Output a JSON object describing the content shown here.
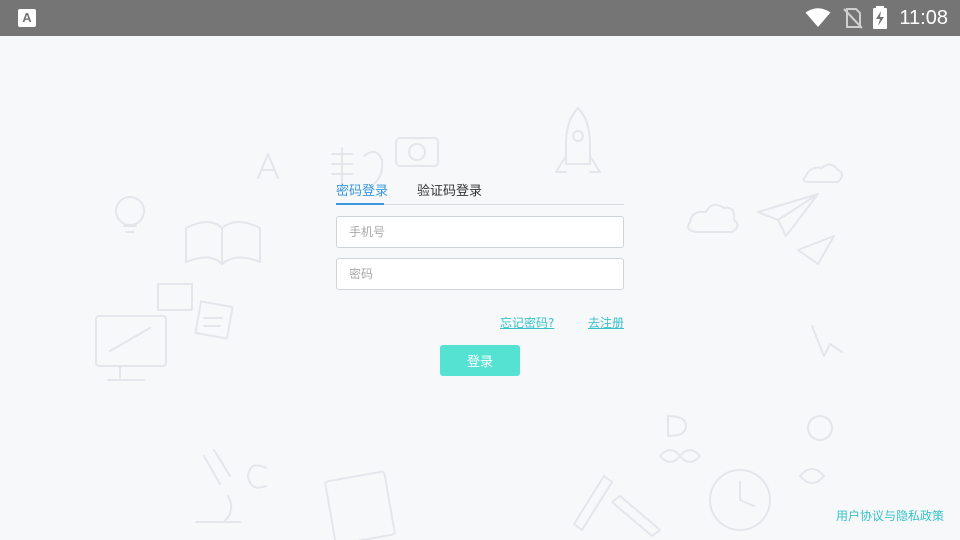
{
  "status_bar": {
    "app_badge": "A",
    "time": "11:08",
    "icons": [
      "wifi-icon",
      "no-sim-icon",
      "battery-charging-icon"
    ]
  },
  "login": {
    "tabs": [
      {
        "label": "密码登录",
        "active": true
      },
      {
        "label": "验证码登录",
        "active": false
      }
    ],
    "phone_placeholder": "手机号",
    "password_placeholder": "密码",
    "forgot_password": "忘记密码?",
    "register": "去注册",
    "submit": "登录"
  },
  "footer": {
    "agreement": "用户协议与隐私政策"
  },
  "colors": {
    "status_bar": "#757575",
    "accent_blue": "#3a96dd",
    "accent_teal": "#39c3c9",
    "button": "#55e2d2",
    "background": "#f6f8fa"
  }
}
